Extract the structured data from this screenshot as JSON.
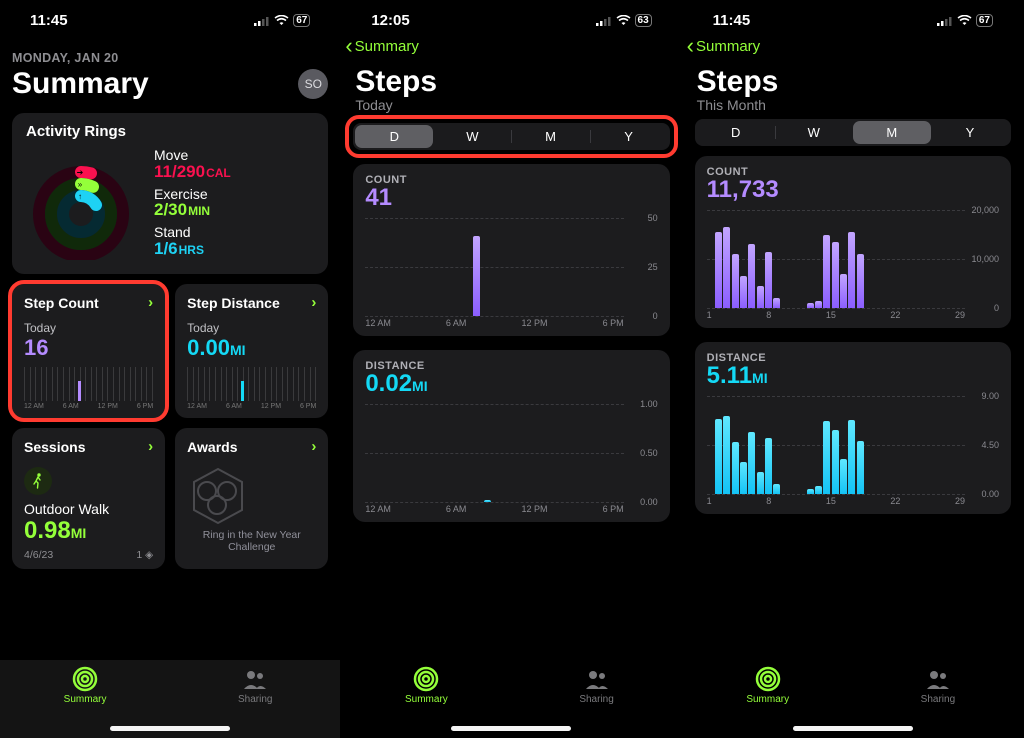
{
  "screen1": {
    "status_time": "11:45",
    "battery": "67",
    "date_line": "MONDAY, JAN 20",
    "title": "Summary",
    "avatar": "SO",
    "rings_title": "Activity Rings",
    "move_label": "Move",
    "move_value": "11/290",
    "move_unit": "CAL",
    "exercise_label": "Exercise",
    "exercise_value": "2/30",
    "exercise_unit": "MIN",
    "stand_label": "Stand",
    "stand_value": "1/6",
    "stand_unit": "HRS",
    "step_count_title": "Step Count",
    "step_dist_title": "Step Distance",
    "today_label": "Today",
    "step_count_val": "16",
    "step_dist_val": "0.00",
    "mi_unit": "MI",
    "mini_times": [
      "12 AM",
      "6 AM",
      "12 PM",
      "6 PM"
    ],
    "sessions_title": "Sessions",
    "awards_title": "Awards",
    "session_name": "Outdoor Walk",
    "session_val": "0.98",
    "session_date": "4/6/23",
    "session_count": "1",
    "award_caption": "Ring in the New Year Challenge",
    "tab_summary": "Summary",
    "tab_sharing": "Sharing"
  },
  "screen2": {
    "status_time": "12:05",
    "battery": "63",
    "back": "Summary",
    "title": "Steps",
    "subtitle": "Today",
    "seg": [
      "D",
      "W",
      "M",
      "Y"
    ],
    "seg_selected": 0,
    "count_label": "COUNT",
    "count_val": "41",
    "count_y": [
      "50",
      "25",
      "0"
    ],
    "count_x": [
      "12 AM",
      "6 AM",
      "12 PM",
      "6 PM"
    ],
    "distance_label": "DISTANCE",
    "distance_val": "0.02",
    "distance_unit": "MI",
    "dist_y": [
      "1.00",
      "0.50",
      "0.00"
    ],
    "dist_x": [
      "12 AM",
      "6 AM",
      "12 PM",
      "6 PM"
    ]
  },
  "screen3": {
    "status_time": "11:45",
    "battery": "67",
    "back": "Summary",
    "title": "Steps",
    "subtitle": "This Month",
    "seg": [
      "D",
      "W",
      "M",
      "Y"
    ],
    "seg_selected": 2,
    "count_label": "COUNT",
    "count_val": "11,733",
    "count_y": [
      "20,000",
      "10,000",
      "0"
    ],
    "count_x": [
      "1",
      "8",
      "15",
      "22",
      "29"
    ],
    "distance_label": "DISTANCE",
    "distance_val": "5.11",
    "distance_unit": "MI",
    "dist_y": [
      "9.00",
      "4.50",
      "0.00"
    ],
    "dist_x": [
      "1",
      "8",
      "15",
      "22",
      "29"
    ]
  },
  "chart_data": {
    "screen2_count": {
      "type": "bar",
      "title": "COUNT",
      "total": 41,
      "x_ticks": [
        "12 AM",
        "6 AM",
        "12 PM",
        "6 PM"
      ],
      "ylim": [
        0,
        50
      ],
      "bars": [
        {
          "hour_approx": 10,
          "value": 41
        }
      ]
    },
    "screen2_distance": {
      "type": "bar",
      "title": "DISTANCE (MI)",
      "total": 0.02,
      "x_ticks": [
        "12 AM",
        "6 AM",
        "12 PM",
        "6 PM"
      ],
      "ylim": [
        0,
        1.0
      ],
      "bars": [
        {
          "hour_approx": 11,
          "value": 0.02
        }
      ]
    },
    "screen3_count": {
      "type": "bar",
      "title": "COUNT",
      "total": 11733,
      "x_ticks": [
        1,
        8,
        15,
        22,
        29
      ],
      "ylim": [
        0,
        20000
      ],
      "bars": [
        {
          "day": 1,
          "value": 15500
        },
        {
          "day": 2,
          "value": 16500
        },
        {
          "day": 3,
          "value": 11000
        },
        {
          "day": 4,
          "value": 6500
        },
        {
          "day": 5,
          "value": 13000
        },
        {
          "day": 6,
          "value": 4500
        },
        {
          "day": 7,
          "value": 11500
        },
        {
          "day": 8,
          "value": 2000
        },
        {
          "day": 12,
          "value": 1000
        },
        {
          "day": 13,
          "value": 1500
        },
        {
          "day": 14,
          "value": 15000
        },
        {
          "day": 15,
          "value": 13500
        },
        {
          "day": 16,
          "value": 7000
        },
        {
          "day": 17,
          "value": 15500
        },
        {
          "day": 18,
          "value": 11000
        }
      ]
    },
    "screen3_distance": {
      "type": "bar",
      "title": "DISTANCE (MI)",
      "total": 5.11,
      "x_ticks": [
        1,
        8,
        15,
        22,
        29
      ],
      "ylim": [
        0,
        9.0
      ],
      "bars": [
        {
          "day": 1,
          "value": 6.9
        },
        {
          "day": 2,
          "value": 7.2
        },
        {
          "day": 3,
          "value": 4.8
        },
        {
          "day": 4,
          "value": 2.9
        },
        {
          "day": 5,
          "value": 5.7
        },
        {
          "day": 6,
          "value": 2.0
        },
        {
          "day": 7,
          "value": 5.1
        },
        {
          "day": 8,
          "value": 0.9
        },
        {
          "day": 12,
          "value": 0.5
        },
        {
          "day": 13,
          "value": 0.7
        },
        {
          "day": 14,
          "value": 6.7
        },
        {
          "day": 15,
          "value": 5.9
        },
        {
          "day": 16,
          "value": 3.2
        },
        {
          "day": 17,
          "value": 6.8
        },
        {
          "day": 18,
          "value": 4.9
        }
      ]
    }
  }
}
